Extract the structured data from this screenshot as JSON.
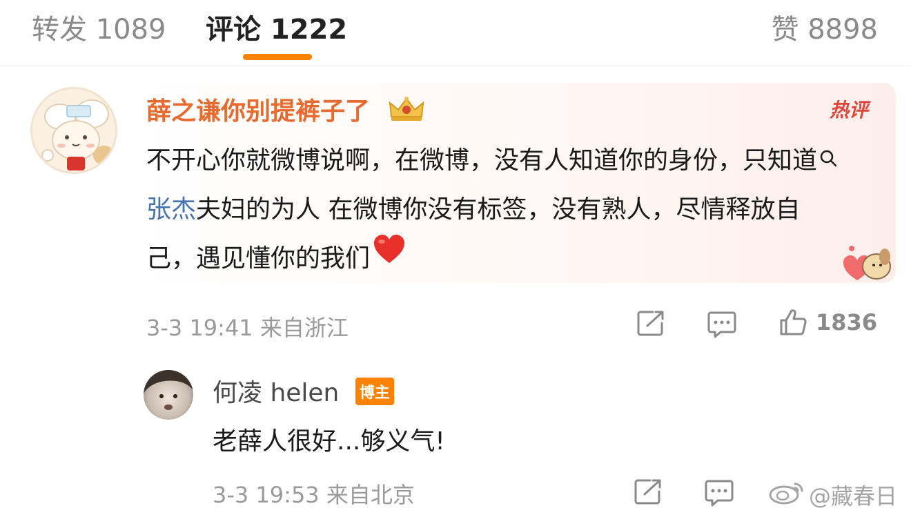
{
  "tabs": {
    "repost": "转发 1089",
    "comments": "评论 1222",
    "likes": "赞 8898"
  },
  "hot_comment": {
    "username": "薛之谦你别提裤子了",
    "badge": "热评",
    "text_before_link": "不开心你就微博说啊，在微博，没有人知道你的身份，只知道",
    "link_text": "张杰",
    "text_after_link": "夫妇的为人  在微博你没有标签，没有熟人，尽情释放自己，遇见懂你的我们",
    "meta": "3-3 19:41 来自浙江",
    "like_count": "1836",
    "icons": [
      "crown-icon",
      "search-icon",
      "heart-icon",
      "share-icon",
      "comment-icon",
      "like-icon"
    ]
  },
  "reply": {
    "username": "何凌 helen",
    "badge": "博主",
    "text": "老薛人很好...够义气!",
    "meta": "3-3 19:53 来自北京"
  },
  "watermark": "@藏春日",
  "colors": {
    "accent": "#ff8200",
    "username_hot": "#e76a2f",
    "hot_badge": "#e2463b",
    "link": "#4573b0",
    "meta": "#9a9a9a"
  }
}
